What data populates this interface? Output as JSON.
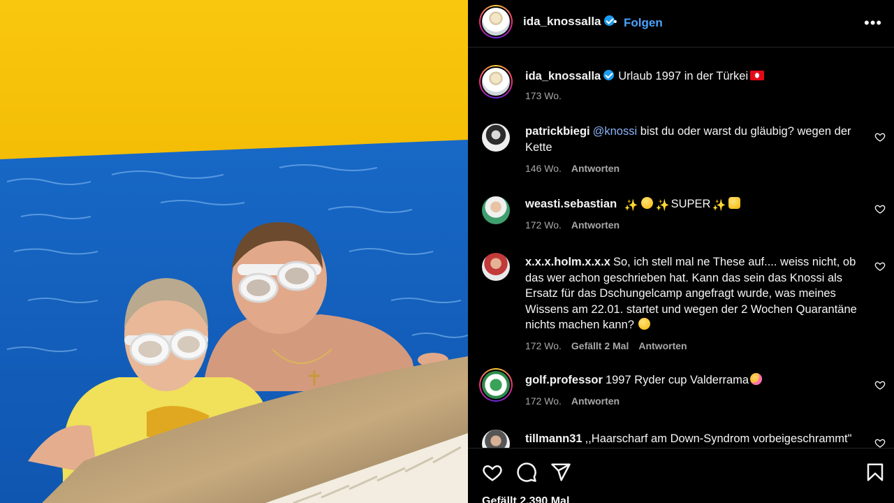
{
  "post": {
    "username": "ida_knossalla",
    "follow_label": "Folgen",
    "caption": "Urlaub 1997 in der Türkei",
    "caption_age": "173 Wo.",
    "likes_label": "Gefällt 2.390 Mal"
  },
  "comments": [
    {
      "user": "patrickbiegi",
      "mention": "@knossi",
      "text": " bist du oder warst du gläubig? wegen der Kette",
      "age": "146 Wo.",
      "likes": "",
      "reply": "Antworten"
    },
    {
      "user": "weasti.sebastian",
      "text": "SUPER",
      "age": "172 Wo.",
      "likes": "",
      "reply": "Antworten"
    },
    {
      "user": "x.x.x.holm.x.x.x",
      "text": "So, ich stell mal ne These auf.... weiss nicht, ob das wer achon geschrieben hat. Kann das sein das Knossi als Ersatz für das Dschungelcamp angefragt wurde, was meines Wissens am 22.01. startet und wegen der 2 Wochen Quarantäne nichts machen kann?",
      "age": "172 Wo.",
      "likes": "Gefällt 2 Mal",
      "reply": "Antworten"
    },
    {
      "user": "golf.professor",
      "text": "1997 Ryder cup Valderrama",
      "age": "172 Wo.",
      "likes": "",
      "reply": "Antworten"
    },
    {
      "user": "tillmann31",
      "text": ",,Haarscharf am Down-Syndrom vorbeigeschrammt\"",
      "age": "",
      "likes": "",
      "reply": ""
    }
  ],
  "icons": {
    "more": "more-options-icon",
    "like": "heart-icon",
    "comment": "comment-icon",
    "share": "share-icon",
    "save": "bookmark-icon"
  },
  "colors": {
    "accent": "#4aa3ff",
    "background": "#000000",
    "muted": "#a8a8a8",
    "pool_wall": "#f6c20c",
    "water": "#1466c4"
  }
}
